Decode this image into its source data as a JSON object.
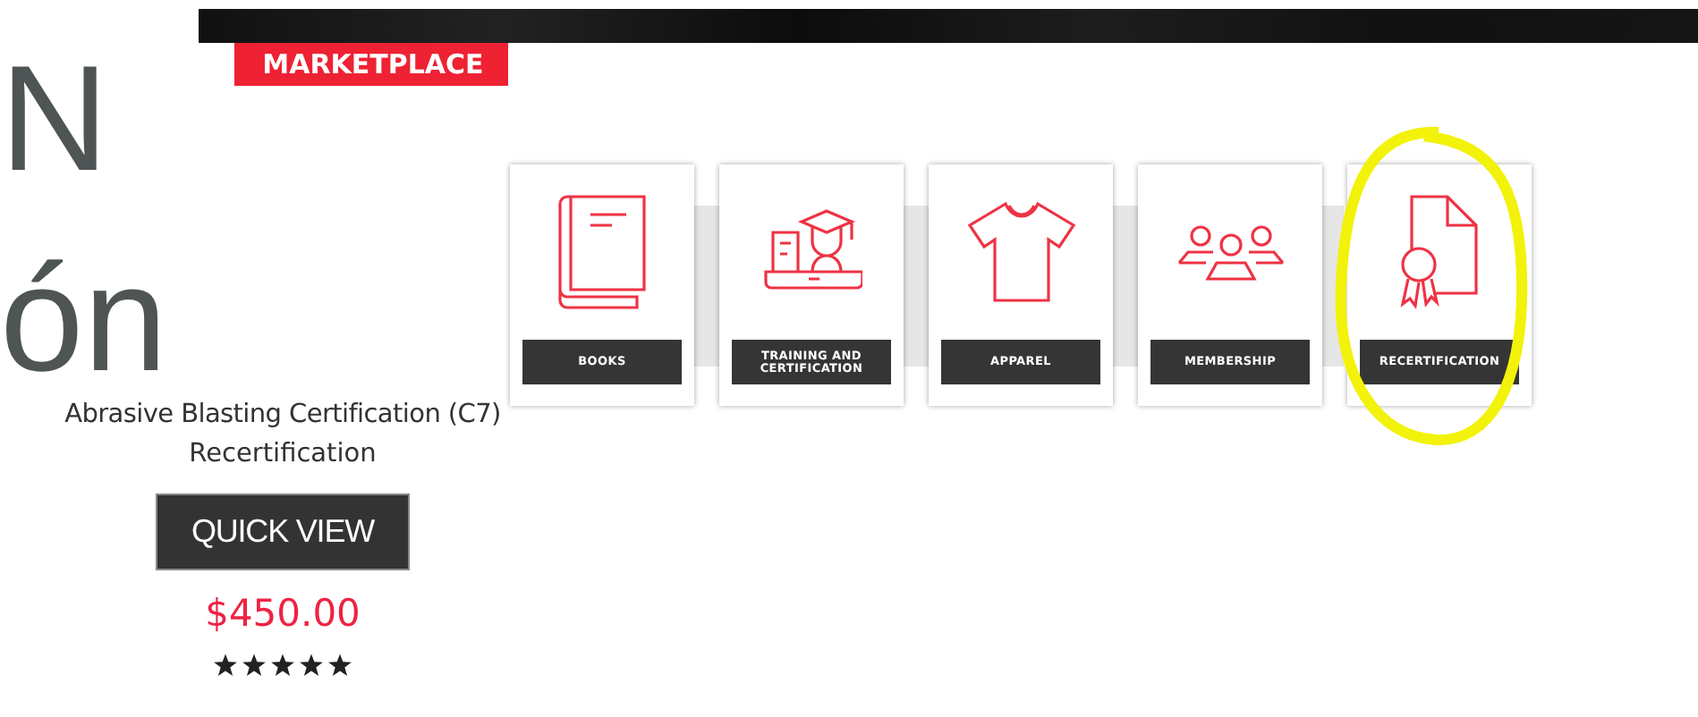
{
  "heading_fragments": [
    "N",
    "ón"
  ],
  "badge": "MARKETPLACE",
  "product": {
    "title": "Abrasive Blasting Certification (C7)",
    "subtitle": "Recertification",
    "button": "QUICK VIEW",
    "price": "$450.00",
    "stars": 5
  },
  "categories": [
    {
      "kind": "book",
      "label": "BOOKS"
    },
    {
      "kind": "training",
      "label": "TRAINING AND CERTIFICATION"
    },
    {
      "kind": "shirt",
      "label": "APPAREL"
    },
    {
      "kind": "people",
      "label": "MEMBERSHIP"
    },
    {
      "kind": "certificate",
      "label": "RECERTIFICATION"
    }
  ]
}
